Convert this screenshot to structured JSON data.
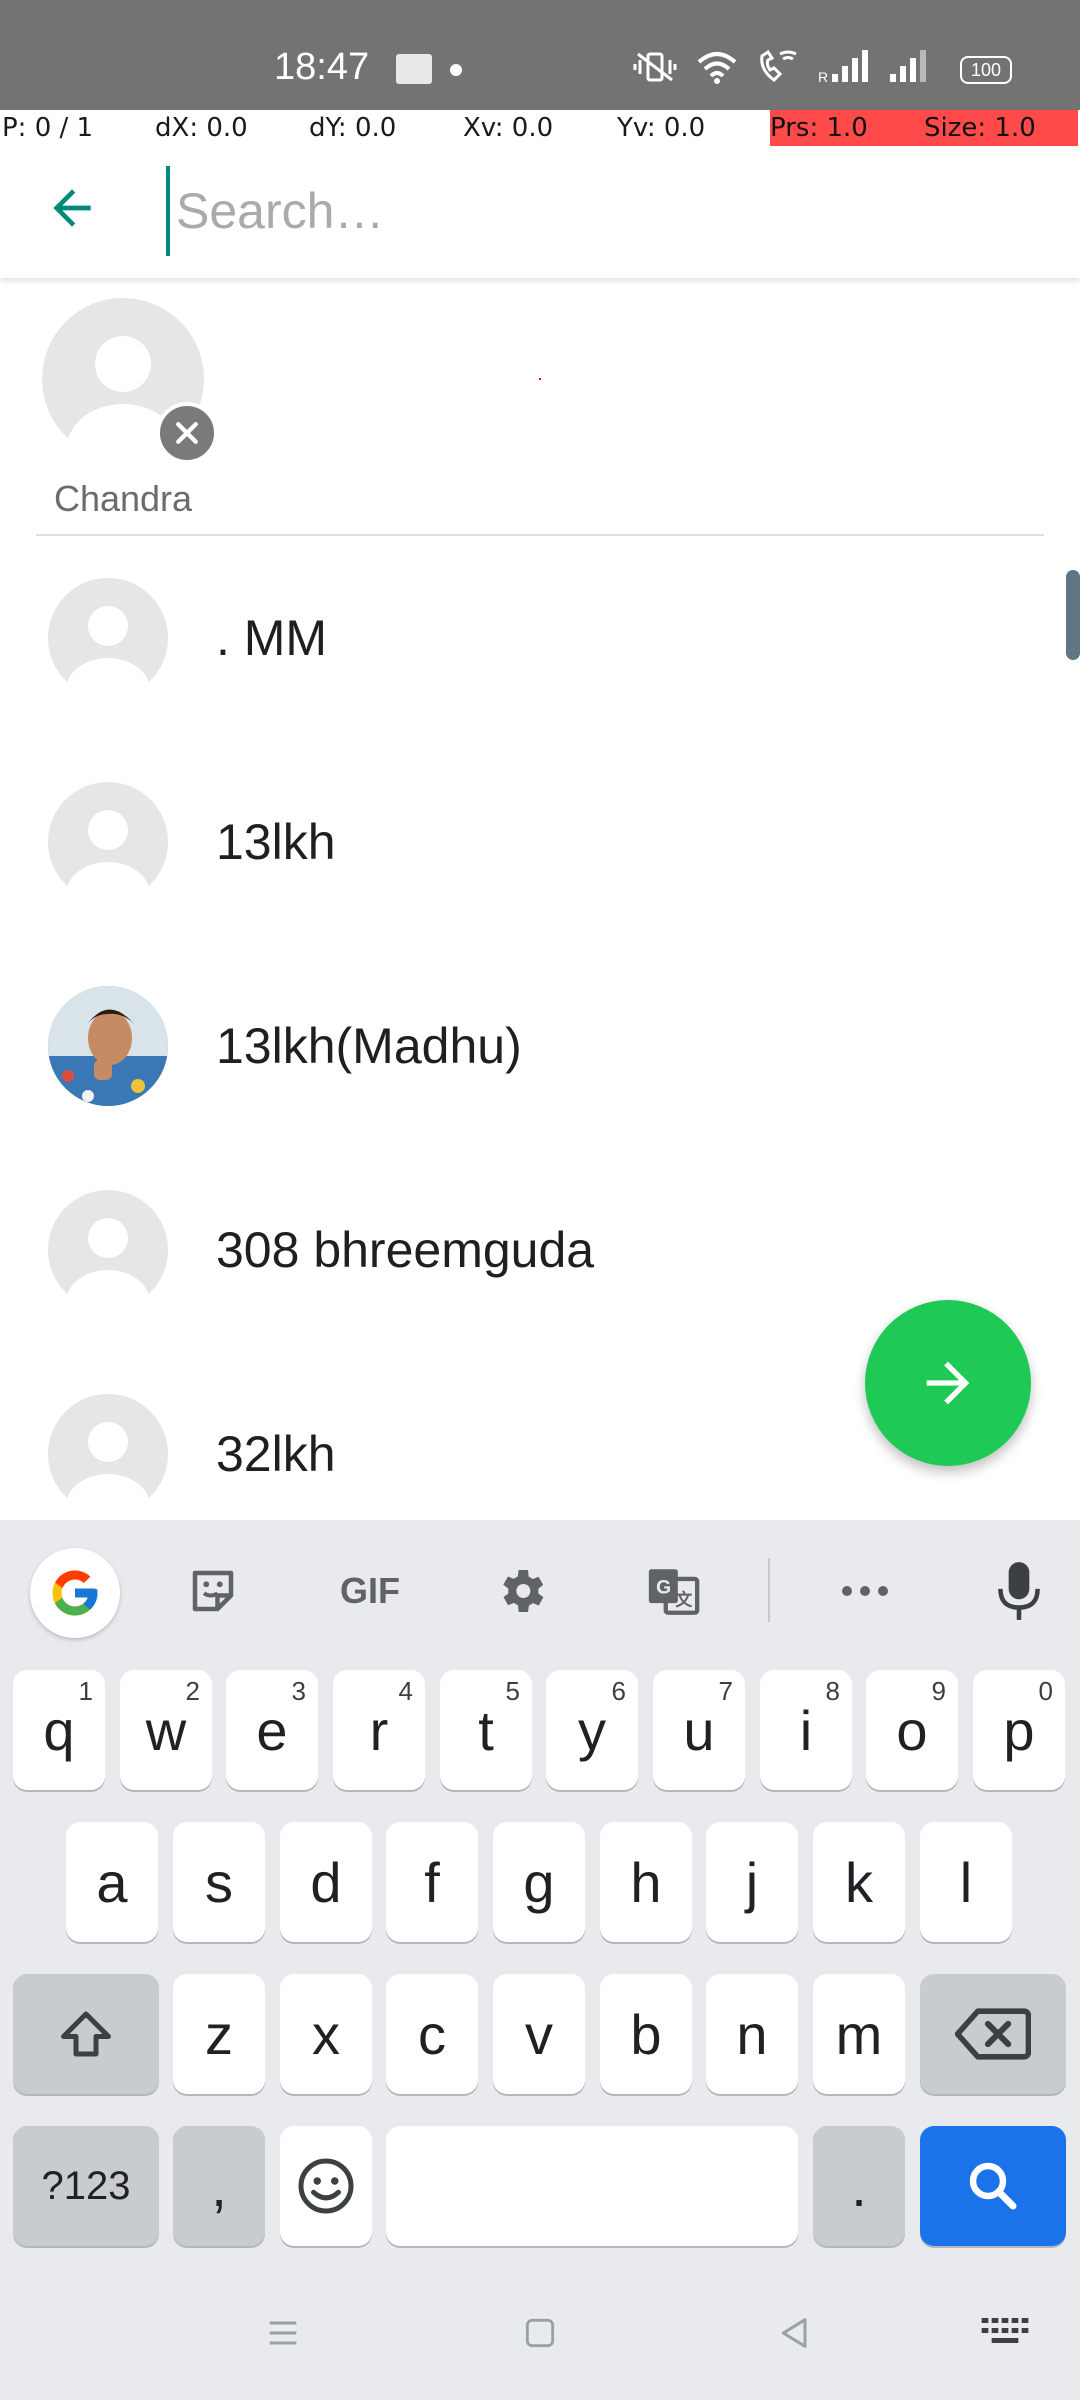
{
  "status_bar": {
    "time": "18:47",
    "battery": "100",
    "icons": [
      "vibrate-icon",
      "wifi-icon",
      "wifi-call-icon",
      "signal-r-icon",
      "signal-icon",
      "battery-icon"
    ]
  },
  "pointer_overlay": {
    "p": "P: 0 / 1",
    "dx": "dX: 0.0",
    "dy": "dY: 0.0",
    "xv": "Xv: 0.0",
    "yv": "Yv: 0.0",
    "prs": "Prs: 1.0",
    "size": "Size: 1.0"
  },
  "toolbar": {
    "search_placeholder": "Search…",
    "search_value": ""
  },
  "selected": [
    {
      "name": "Chandra"
    }
  ],
  "contacts": [
    {
      "name": ". MM",
      "photo": false
    },
    {
      "name": "13lkh",
      "photo": false
    },
    {
      "name": "13lkh(Madhu)",
      "photo": true
    },
    {
      "name": "308 bhreemguda",
      "photo": false
    },
    {
      "name": "32lkh",
      "photo": false
    }
  ],
  "colors": {
    "accent": "#00897b",
    "fab": "#1fc955",
    "search_key": "#1a73e8"
  },
  "keyboard": {
    "toolbar": {
      "gif": "GIF"
    },
    "row1": [
      {
        "k": "q",
        "h": "1"
      },
      {
        "k": "w",
        "h": "2"
      },
      {
        "k": "e",
        "h": "3"
      },
      {
        "k": "r",
        "h": "4"
      },
      {
        "k": "t",
        "h": "5"
      },
      {
        "k": "y",
        "h": "6"
      },
      {
        "k": "u",
        "h": "7"
      },
      {
        "k": "i",
        "h": "8"
      },
      {
        "k": "o",
        "h": "9"
      },
      {
        "k": "p",
        "h": "0"
      }
    ],
    "row2": [
      "a",
      "s",
      "d",
      "f",
      "g",
      "h",
      "j",
      "k",
      "l"
    ],
    "row3": [
      "z",
      "x",
      "c",
      "v",
      "b",
      "n",
      "m"
    ],
    "symbols": "?123",
    "comma": ",",
    "period": "."
  }
}
